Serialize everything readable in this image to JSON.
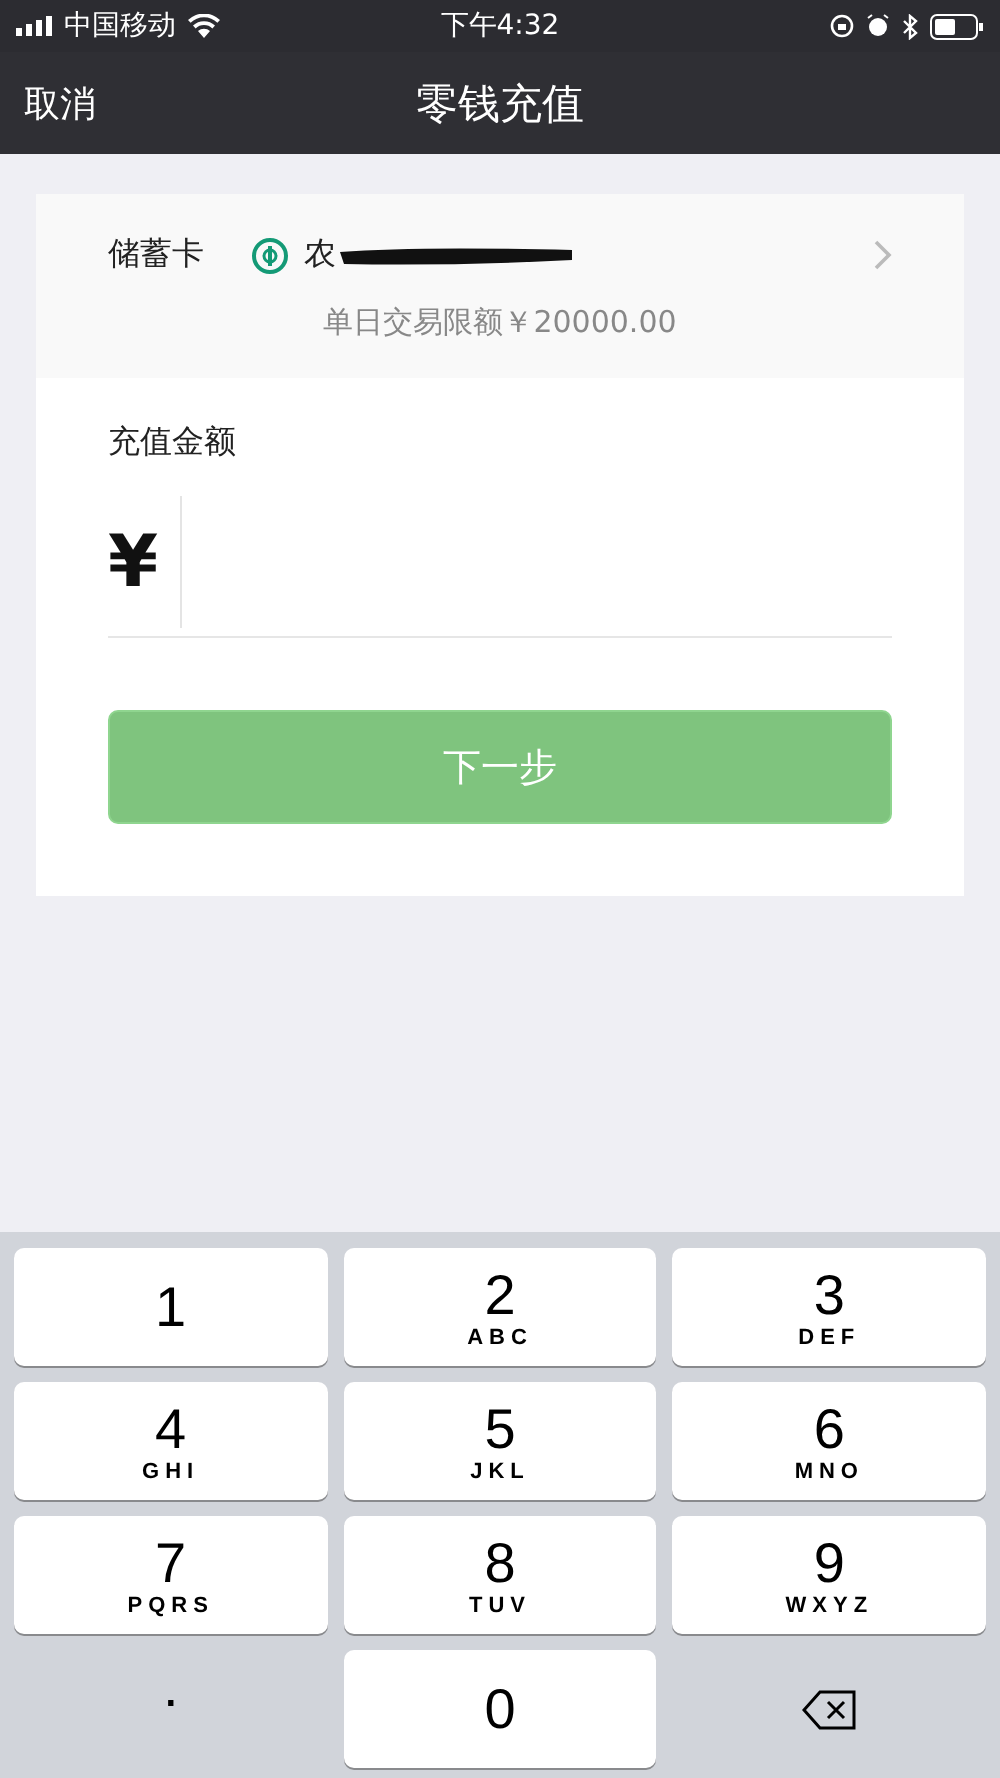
{
  "status_bar": {
    "carrier": "中国移动",
    "time": "下午4:32"
  },
  "nav": {
    "cancel": "取消",
    "title": "零钱充值"
  },
  "card": {
    "label": "储蓄卡",
    "bank_name": "农",
    "limit": "单日交易限额￥20000.00"
  },
  "amount": {
    "label": "充值金额",
    "currency": "¥"
  },
  "next_button": {
    "label": "下一步",
    "disabled": true
  },
  "keypad": [
    {
      "kind": "digit",
      "digit": "1"
    },
    {
      "kind": "digit",
      "digit": "2",
      "letters": "ABC"
    },
    {
      "kind": "digit",
      "digit": "3",
      "letters": "DEF"
    },
    {
      "kind": "digit",
      "digit": "4",
      "letters": "GHI"
    },
    {
      "kind": "digit",
      "digit": "5",
      "letters": "JKL"
    },
    {
      "kind": "digit",
      "digit": "6",
      "letters": "MNO"
    },
    {
      "kind": "digit",
      "digit": "7",
      "letters": "PQRS"
    },
    {
      "kind": "digit",
      "digit": "8",
      "letters": "TUV"
    },
    {
      "kind": "digit",
      "digit": "9",
      "letters": "WXYZ"
    },
    {
      "kind": "dot",
      "digit": "."
    },
    {
      "kind": "digit",
      "digit": "0"
    },
    {
      "kind": "delete"
    }
  ]
}
